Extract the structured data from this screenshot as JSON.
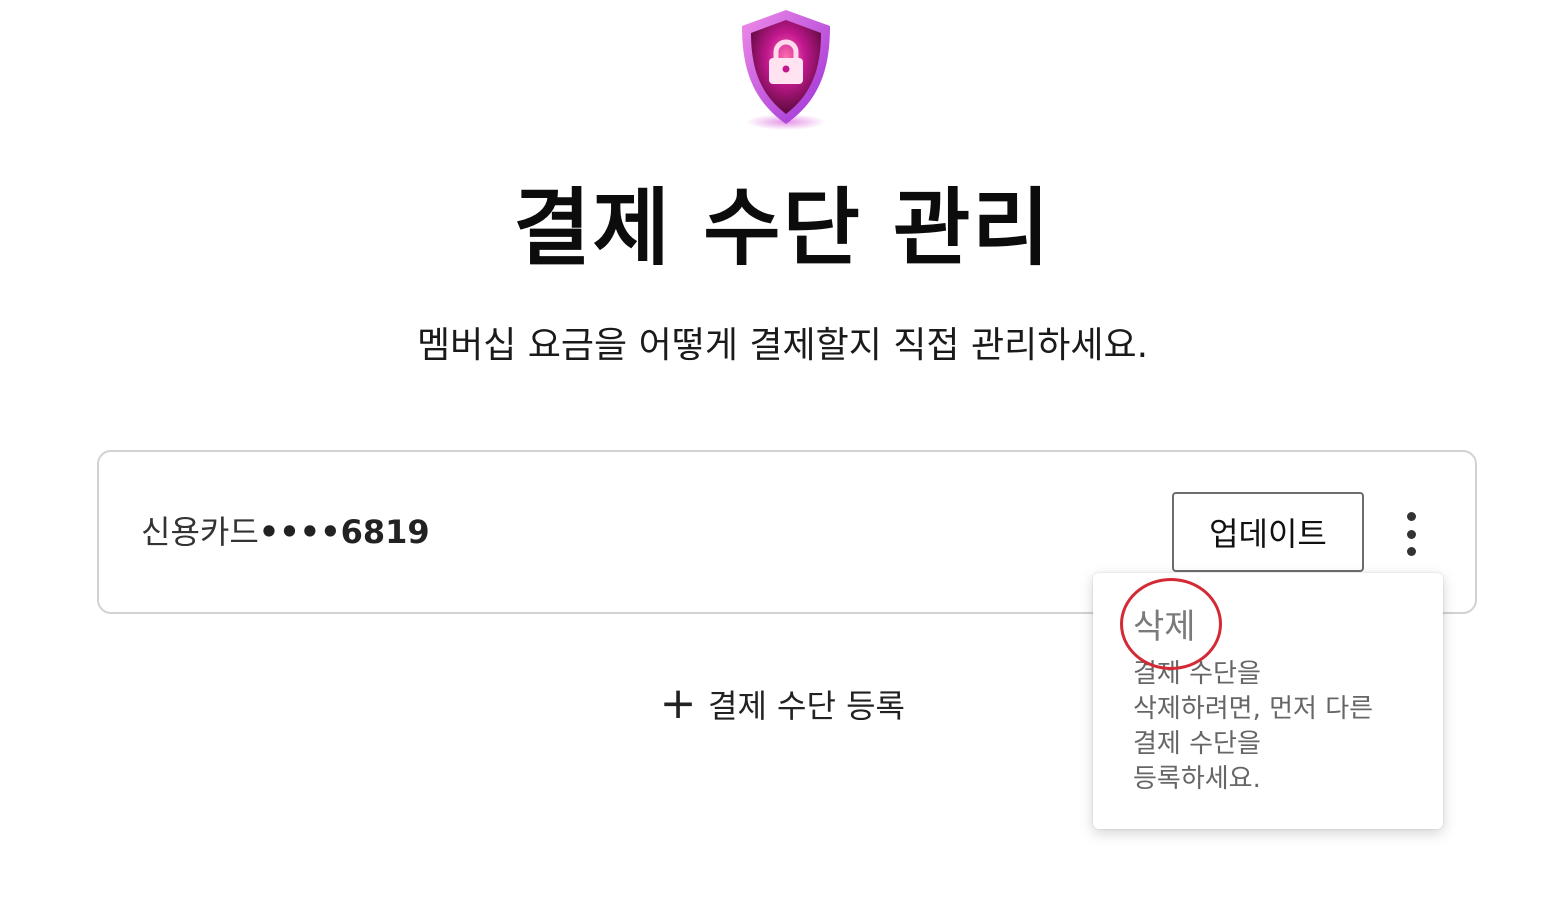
{
  "header": {
    "icon": "shield-lock-icon",
    "title": "결제 수단 관리",
    "subtitle": "멤버십 요금을 어떻게 결제할지 직접 관리하세요."
  },
  "payment_method": {
    "type_label": "신용카드",
    "masked_number": "••••6819",
    "update_label": "업데이트",
    "more_icon": "more-vertical-icon"
  },
  "menu": {
    "delete_label": "삭제",
    "note_lines": [
      "결제 수단을",
      "삭제하려면, 먼저 다른",
      "결제 수단을",
      "등록하세요."
    ]
  },
  "add_method": {
    "icon": "plus-icon",
    "label": "결제 수단 등록"
  },
  "colors": {
    "highlight": "#d42a35",
    "shield_primary": "#c2188f",
    "shield_dark": "#6a0a3a"
  }
}
